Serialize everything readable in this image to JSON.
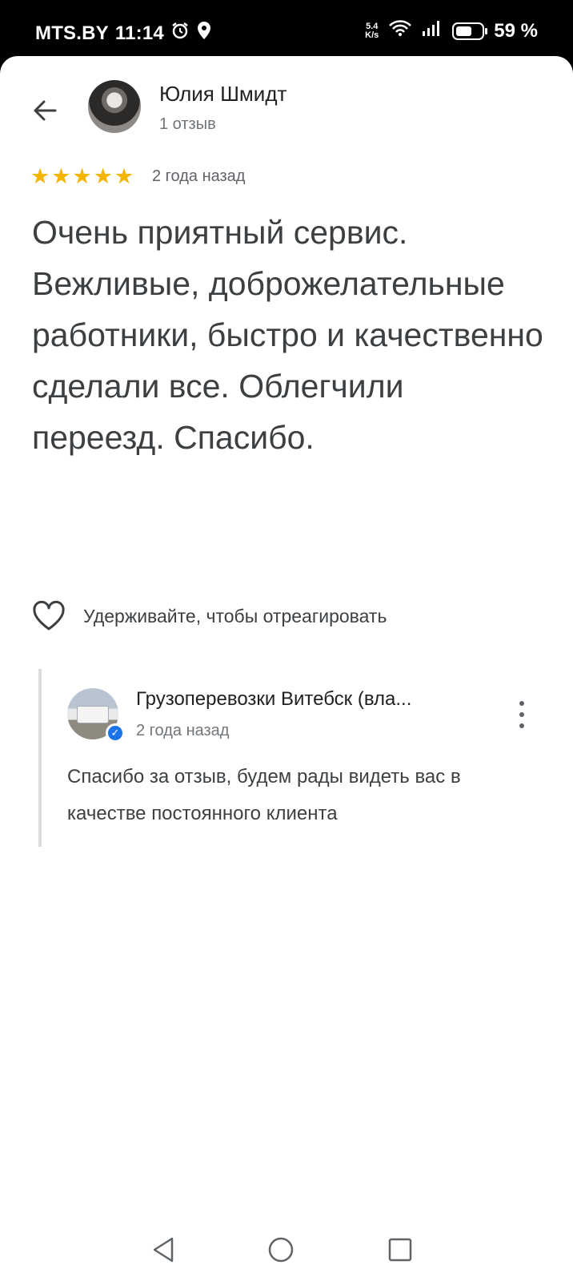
{
  "status_bar": {
    "carrier": "MTS.BY",
    "time": "11:14",
    "net_speed_value": "5.4",
    "net_speed_unit": "K/s",
    "battery_level": 0.59,
    "battery_text": "59 %"
  },
  "header": {
    "back_icon": "arrow-left-icon",
    "author_name": "Юлия Шмидт",
    "author_reviews": "1 отзыв"
  },
  "review": {
    "rating": 5,
    "rating_max": 5,
    "date": "2 года назад",
    "text": "Очень приятный сервис. Вежливые, доброжелательные работники, быстро и качественно сделали все. Облегчили переезд. Спасибо."
  },
  "reaction": {
    "icon": "heart-outline-icon",
    "label": "Удерживайте, чтобы отреагировать"
  },
  "owner_reply": {
    "name": "Грузоперевозки Витебск (вла...",
    "date": "2 года назад",
    "text": "Спасибо за отзыв, будем рады видеть вас в качестве постоянного клиента",
    "more_icon": "more-vert-icon"
  },
  "colors": {
    "star": "#f4b400",
    "verified": "#1a73e8",
    "text_primary": "#202124",
    "text_secondary": "#70757a"
  }
}
